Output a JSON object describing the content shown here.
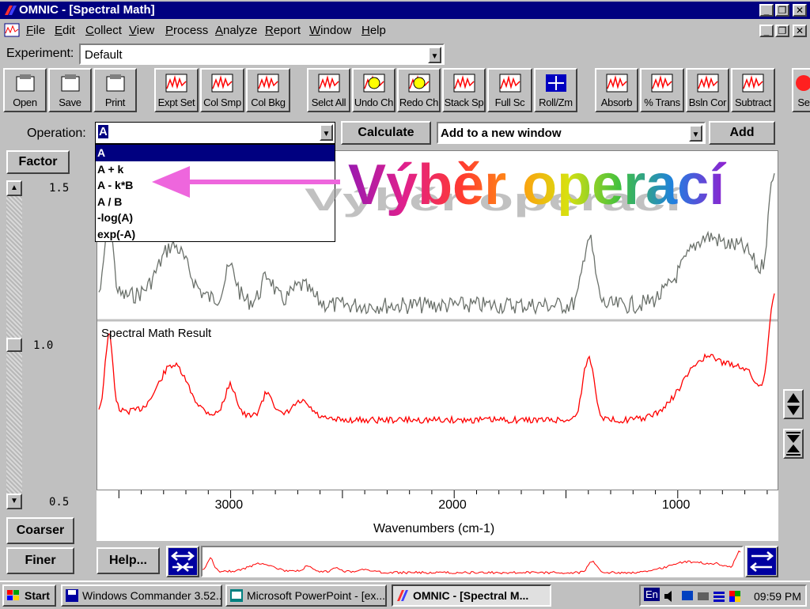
{
  "window": {
    "title": "OMNIC - [Spectral Math]"
  },
  "menu": [
    {
      "ul": "F",
      "rest": "ile"
    },
    {
      "ul": "E",
      "rest": "dit"
    },
    {
      "ul": "C",
      "rest": "ollect"
    },
    {
      "ul": "V",
      "rest": "iew"
    },
    {
      "ul": "P",
      "rest": "rocess"
    },
    {
      "ul": "A",
      "rest": "nalyze"
    },
    {
      "ul": "R",
      "rest": "eport"
    },
    {
      "ul": "W",
      "rest": "indow"
    },
    {
      "ul": "H",
      "rest": "elp"
    }
  ],
  "experiment": {
    "label": "Experiment:",
    "value": "Default"
  },
  "toolbar": [
    "Open",
    "Save",
    "Print",
    "Expt Set",
    "Col Smp",
    "Col Bkg",
    "Selct All",
    "Undo Ch",
    "Redo Ch",
    "Stack Sp",
    "Full Sc",
    "Roll/Zm",
    "Absorb",
    "% Trans",
    "Bsln Cor",
    "Subtract",
    "Se"
  ],
  "operation": {
    "label": "Operation:",
    "value": "A",
    "options": [
      "A",
      "A + k",
      "A - k*B",
      "A / B",
      "-log(A)",
      "exp(-A)"
    ],
    "calculate": "Calculate",
    "destination": "Add to a new window",
    "add": "Add"
  },
  "factor": {
    "button": "Factor",
    "max": "1.5",
    "mid": "1.0",
    "min": "0.5",
    "level": 0.5,
    "coarser": "Coarser",
    "finer": "Finer"
  },
  "annotation": {
    "text": "Výběr operací"
  },
  "chart": {
    "result_label": "Spectral Math Result",
    "xlabel": "Wavenumbers (cm-1)",
    "ticks": [
      "3000",
      "2000",
      "1000"
    ],
    "tick_values": [
      3000,
      2000,
      1000
    ],
    "xlim": [
      3600,
      550
    ]
  },
  "help": "Help...",
  "taskbar": {
    "start": "Start",
    "tasks": [
      "Windows Commander 3.52...",
      "Microsoft PowerPoint - [ex...",
      "OMNIC - [Spectral M..."
    ],
    "lang": "En",
    "time": "09:59 PM"
  },
  "colors": {
    "titlebar": "#000080",
    "top_spectrum": "#6b716b",
    "result_spectrum": "#ff0000",
    "arrow": "#ee66dd"
  }
}
